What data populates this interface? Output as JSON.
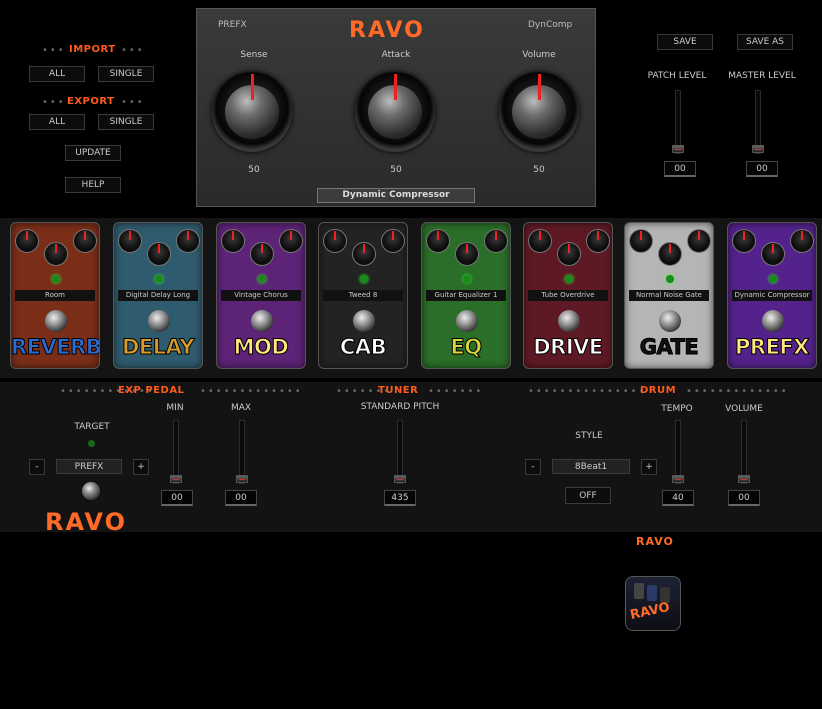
{
  "left": {
    "import_label": "IMPORT",
    "import_all": "ALL",
    "import_single": "SINGLE",
    "export_label": "EXPORT",
    "export_all": "ALL",
    "export_single": "SINGLE",
    "update": "UPDATE",
    "help": "HELP"
  },
  "panel": {
    "left_tag": "PREFX",
    "logo": "RAVO",
    "right_tag": "DynComp",
    "knobs": [
      {
        "label": "Sense",
        "value": "50"
      },
      {
        "label": "Attack",
        "value": "50"
      },
      {
        "label": "Volume",
        "value": "50"
      }
    ],
    "effect_name": "Dynamic Compressor"
  },
  "right": {
    "save": "SAVE",
    "save_as": "SAVE AS",
    "patch_level_label": "PATCH LEVEL",
    "master_level_label": "MASTER LEVEL",
    "patch_level_value": "00",
    "master_level_value": "00"
  },
  "pedals": [
    {
      "title": "REVERB",
      "name": "Room",
      "body": "#7a2e18",
      "title_color": "#2a6cd6"
    },
    {
      "title": "DELAY",
      "name": "Digital Delay Long",
      "body": "#2f5b6e",
      "title_color": "#d89a2a"
    },
    {
      "title": "MOD",
      "name": "Vintage Chorus",
      "body": "#5d2377",
      "title_color": "#ffe97a"
    },
    {
      "title": "CAB",
      "name": "Tweed 8",
      "body": "#232323",
      "title_color": "#ffffff"
    },
    {
      "title": "EQ",
      "name": "Guitar Equalizer 1",
      "body": "#2b6e29",
      "title_color": "#d6d63a"
    },
    {
      "title": "DRIVE",
      "name": "Tube Overdrive",
      "body": "#5e1a24",
      "title_color": "#ffffff"
    },
    {
      "title": "GATE",
      "name": "Normal Noise Gate",
      "body": "#b5b5b5",
      "title_color": "#111111"
    },
    {
      "title": "PREFX",
      "name": "Dynamic Compressor",
      "body": "#53228a",
      "title_color": "#ffe97a"
    }
  ],
  "exp": {
    "section_label": "EXP PEDAL",
    "target_label": "TARGET",
    "minus": "-",
    "plus": "+",
    "target_value": "PREFX",
    "min_label": "MIN",
    "max_label": "MAX",
    "min_value": "00",
    "max_value": "00",
    "logo": "RAVO"
  },
  "tuner": {
    "section_label": "TUNER",
    "pitch_label": "STANDARD PITCH",
    "pitch_value": "435"
  },
  "drum": {
    "section_label": "DRUM",
    "style_label": "STYLE",
    "minus": "-",
    "plus": "+",
    "style_value": "8Beat1",
    "off": "OFF",
    "tempo_label": "TEMPO",
    "tempo_value": "40",
    "volume_label": "VOLUME",
    "volume_value": "00"
  },
  "footer": {
    "logo": "RAVO",
    "icon_text": "RAVO"
  }
}
